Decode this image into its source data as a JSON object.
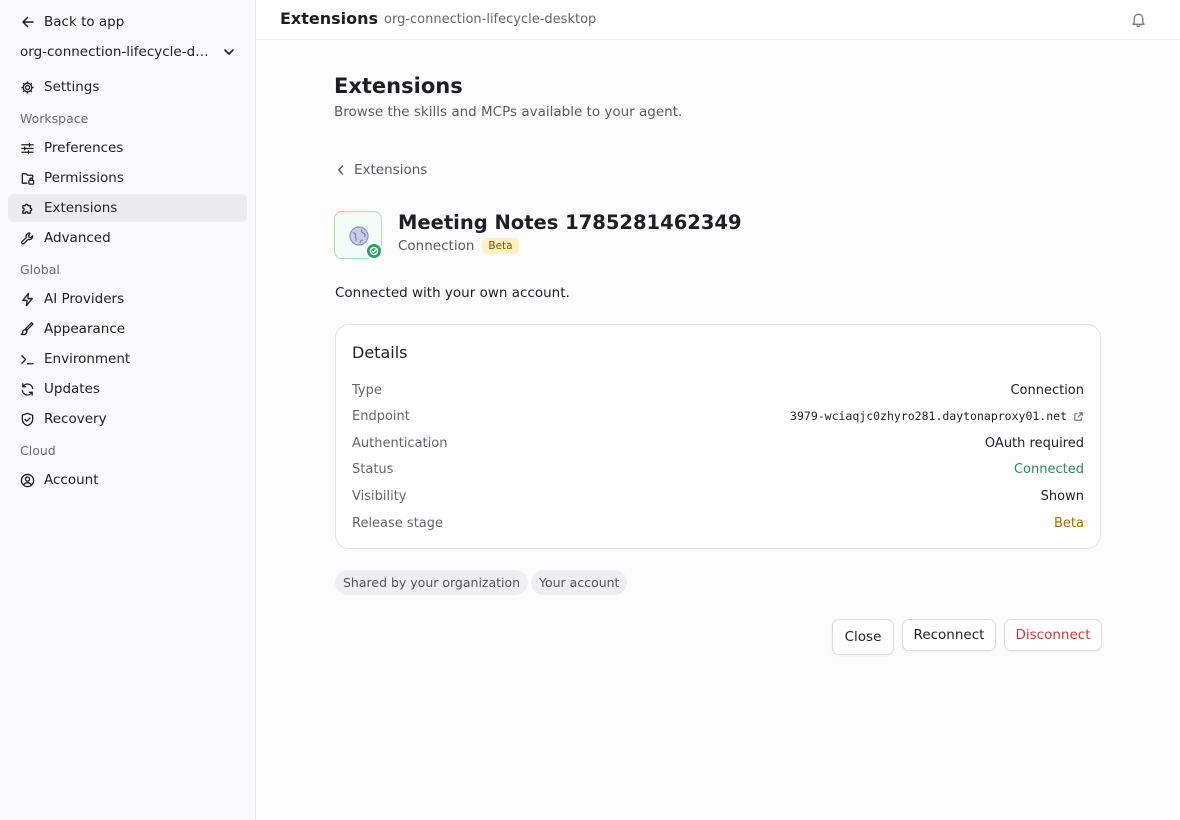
{
  "sidebar": {
    "back_label": "Back to app",
    "workspace": "org-connection-lifecycle-desktop",
    "settings_label": "Settings",
    "sections": {
      "workspace": "Workspace",
      "global": "Global",
      "cloud": "Cloud"
    },
    "items": [
      {
        "label": "Preferences",
        "icon": "sliders-icon"
      },
      {
        "label": "Permissions",
        "icon": "folder-lock-icon"
      },
      {
        "label": "Extensions",
        "icon": "puzzle-icon",
        "active": true
      },
      {
        "label": "Advanced",
        "icon": "wrench-icon"
      },
      {
        "label": "AI Providers",
        "icon": "bolt-icon"
      },
      {
        "label": "Appearance",
        "icon": "paintbrush-icon"
      },
      {
        "label": "Environment",
        "icon": "terminal-icon"
      },
      {
        "label": "Updates",
        "icon": "refresh-icon"
      },
      {
        "label": "Recovery",
        "icon": "shield-check-icon"
      },
      {
        "label": "Account",
        "icon": "user-circle-icon"
      }
    ]
  },
  "topbar": {
    "title": "Extensions",
    "subtitle": "org-connection-lifecycle-desktop"
  },
  "main": {
    "title": "Extensions",
    "subtitle": "Browse the skills and MCPs available to your agent.",
    "breadcrumb": "Extensions",
    "extension": {
      "name": "Meeting Notes 1785281462349",
      "type": "Connection",
      "badge": "Beta",
      "message": "Connected with your own account."
    },
    "details": {
      "title": "Details",
      "rows": [
        {
          "key": "Type",
          "value": "Connection"
        },
        {
          "key": "Endpoint",
          "value": "3979-wciaqjc0zhyro281.daytonaproxy01.net"
        },
        {
          "key": "Authentication",
          "value": "OAuth required"
        },
        {
          "key": "Status",
          "value": "Connected"
        },
        {
          "key": "Visibility",
          "value": "Shown"
        },
        {
          "key": "Release stage",
          "value": "Beta"
        }
      ]
    },
    "chips": [
      "Shared by your organization",
      "Your account"
    ],
    "buttons": {
      "close": "Close",
      "reconnect": "Reconnect",
      "disconnect": "Disconnect"
    }
  },
  "colors": {
    "accent_green": "#2a8a55",
    "beta_amber": "#a86a00",
    "danger_red": "#cc3b3b"
  }
}
